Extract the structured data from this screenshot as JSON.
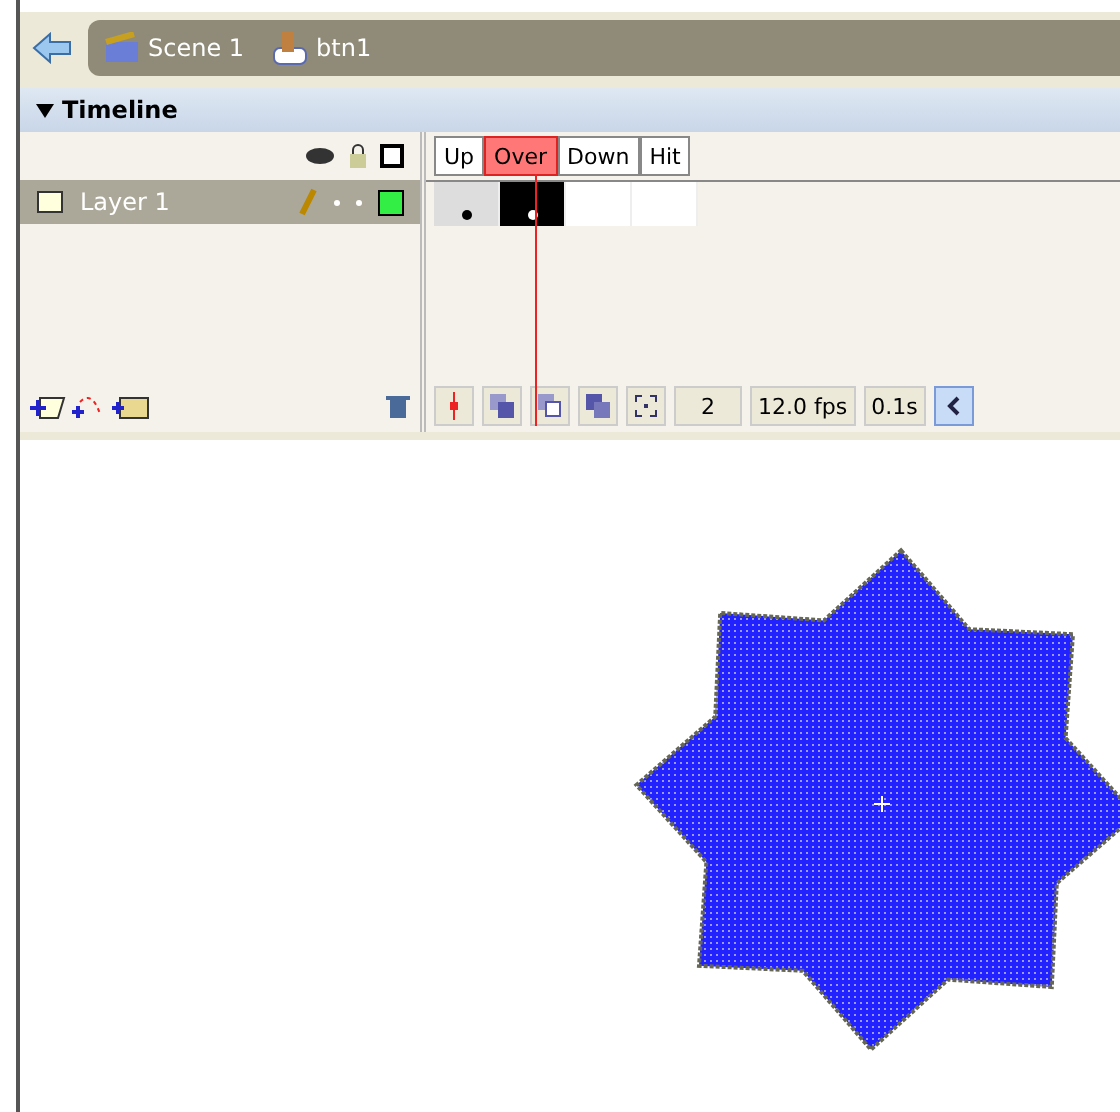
{
  "breadcrumb": [
    {
      "kind": "scene",
      "label": "Scene 1"
    },
    {
      "kind": "symbol",
      "label": "btn1"
    }
  ],
  "timeline": {
    "title": "Timeline",
    "expanded": true,
    "layers": [
      {
        "name": "Layer 1",
        "selected": true,
        "color": "#33ee44"
      }
    ],
    "frames": [
      {
        "label": "Up",
        "selected": false
      },
      {
        "label": "Over",
        "selected": true
      },
      {
        "label": "Down",
        "selected": false
      },
      {
        "label": "Hit",
        "selected": false
      }
    ],
    "cells": [
      {
        "keyframe": true,
        "selected": false
      },
      {
        "keyframe": true,
        "selected": true
      },
      {
        "keyframe": false,
        "selected": false
      },
      {
        "keyframe": false,
        "selected": false
      }
    ],
    "status": {
      "frame": "2",
      "rate": "12.0 fps",
      "time": "0.1s"
    }
  }
}
